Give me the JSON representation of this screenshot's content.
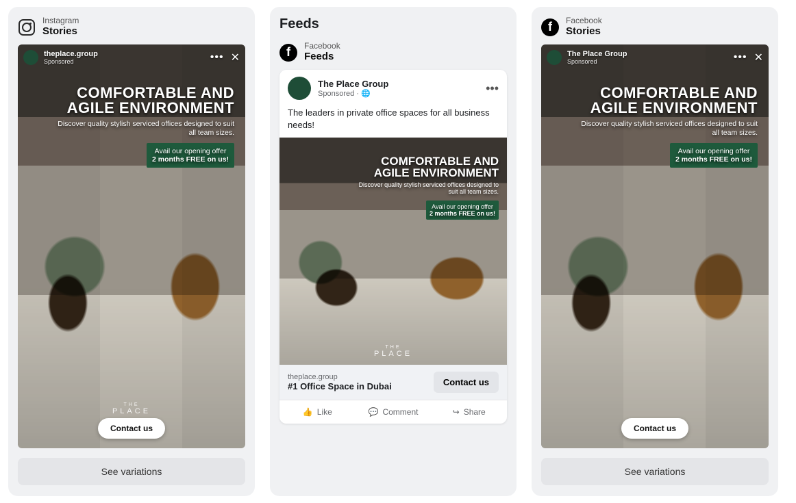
{
  "creative": {
    "headline": "COMFORTABLE AND AGILE ENVIRONMENT",
    "sub": "Discover quality stylish serviced offices designed to suit all team sizes.",
    "offer_line1": "Avail our opening offer",
    "offer_line2": "2 months FREE on us!",
    "brand_small": "THE",
    "brand": "PLACE",
    "cta": "Contact us"
  },
  "panels": [
    {
      "platform_small": "Instagram",
      "platform_big": "Stories",
      "story_account": "theplace.group",
      "story_sub": "Sponsored",
      "variations": "See variations"
    },
    {
      "title": "Feeds",
      "sub_small": "Facebook",
      "sub_big": "Feeds",
      "page_name": "The Place Group",
      "page_sub": "Sponsored · 🌐",
      "body": "The leaders in private office spaces for all business needs!",
      "link_domain": "theplace.group",
      "link_title": "#1 Office Space in Dubai",
      "actions": {
        "like": "Like",
        "comment": "Comment",
        "share": "Share"
      }
    },
    {
      "platform_small": "Facebook",
      "platform_big": "Stories",
      "story_account": "The Place Group",
      "story_sub": "Sponsored",
      "variations": "See variations"
    }
  ]
}
